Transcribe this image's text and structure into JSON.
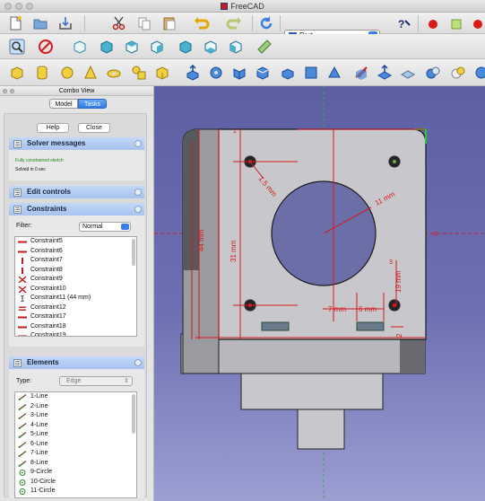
{
  "window": {
    "title": "FreeCAD"
  },
  "toolbar": {
    "workbench": "Part"
  },
  "combo_view": {
    "title": "Combo View",
    "tabs": [
      "Model",
      "Tasks"
    ],
    "help_label": "Help",
    "close_label": "Close",
    "solver": {
      "title": "Solver messages",
      "status": "Fully constrained sketch",
      "solved_in": "Solved in 0 sec"
    },
    "edit_controls": {
      "title": "Edit controls"
    },
    "constraints": {
      "title": "Constraints",
      "filter_label": "Filter:",
      "filter_value": "Normal",
      "items": [
        {
          "label": "Constraint5",
          "icon": "horizontal-icon"
        },
        {
          "label": "Constraint6",
          "icon": "horizontal-icon"
        },
        {
          "label": "Constraint7",
          "icon": "vertical-icon"
        },
        {
          "label": "Constraint8",
          "icon": "vertical-icon"
        },
        {
          "label": "Constraint9",
          "icon": "symmetric-icon"
        },
        {
          "label": "Constraint10",
          "icon": "symmetric-icon"
        },
        {
          "label": "Constraint11 (44 mm)",
          "icon": "vertical-distance-icon"
        },
        {
          "label": "Constraint12",
          "icon": "equal-icon"
        },
        {
          "label": "Constraint17",
          "icon": "horizontal-icon"
        },
        {
          "label": "Constraint18",
          "icon": "horizontal-icon"
        },
        {
          "label": "Constraint19",
          "icon": "horizontal-icon"
        }
      ]
    },
    "elements": {
      "title": "Elements",
      "type_label": "Type:",
      "type_value": "Edge",
      "items": [
        {
          "label": "1-Line",
          "icon": "line-icon"
        },
        {
          "label": "2-Line",
          "icon": "line-icon"
        },
        {
          "label": "3-Line",
          "icon": "line-icon"
        },
        {
          "label": "4-Line",
          "icon": "line-icon"
        },
        {
          "label": "5-Line",
          "icon": "line-icon"
        },
        {
          "label": "6-Line",
          "icon": "line-icon"
        },
        {
          "label": "7-Line",
          "icon": "line-icon"
        },
        {
          "label": "8-Line",
          "icon": "line-icon"
        },
        {
          "label": "9-Circle",
          "icon": "circle-icon"
        },
        {
          "label": "10-Circle",
          "icon": "circle-icon"
        },
        {
          "label": "11-Circle",
          "icon": "circle-icon"
        }
      ]
    }
  },
  "sketch": {
    "dimensions": {
      "hole_diameter": "1.5 mm",
      "bore_radius": "11 mm",
      "height_total": "44 mm",
      "hole_spacing": "31 mm",
      "offset_7": "7 mm",
      "offset_6": "6 mm",
      "offset_19": "19 mm",
      "offset_2": "2"
    },
    "colors": {
      "constraint": "#d41a1a",
      "geometry": "#ffffff",
      "background_top": "#5d5fa3"
    }
  }
}
